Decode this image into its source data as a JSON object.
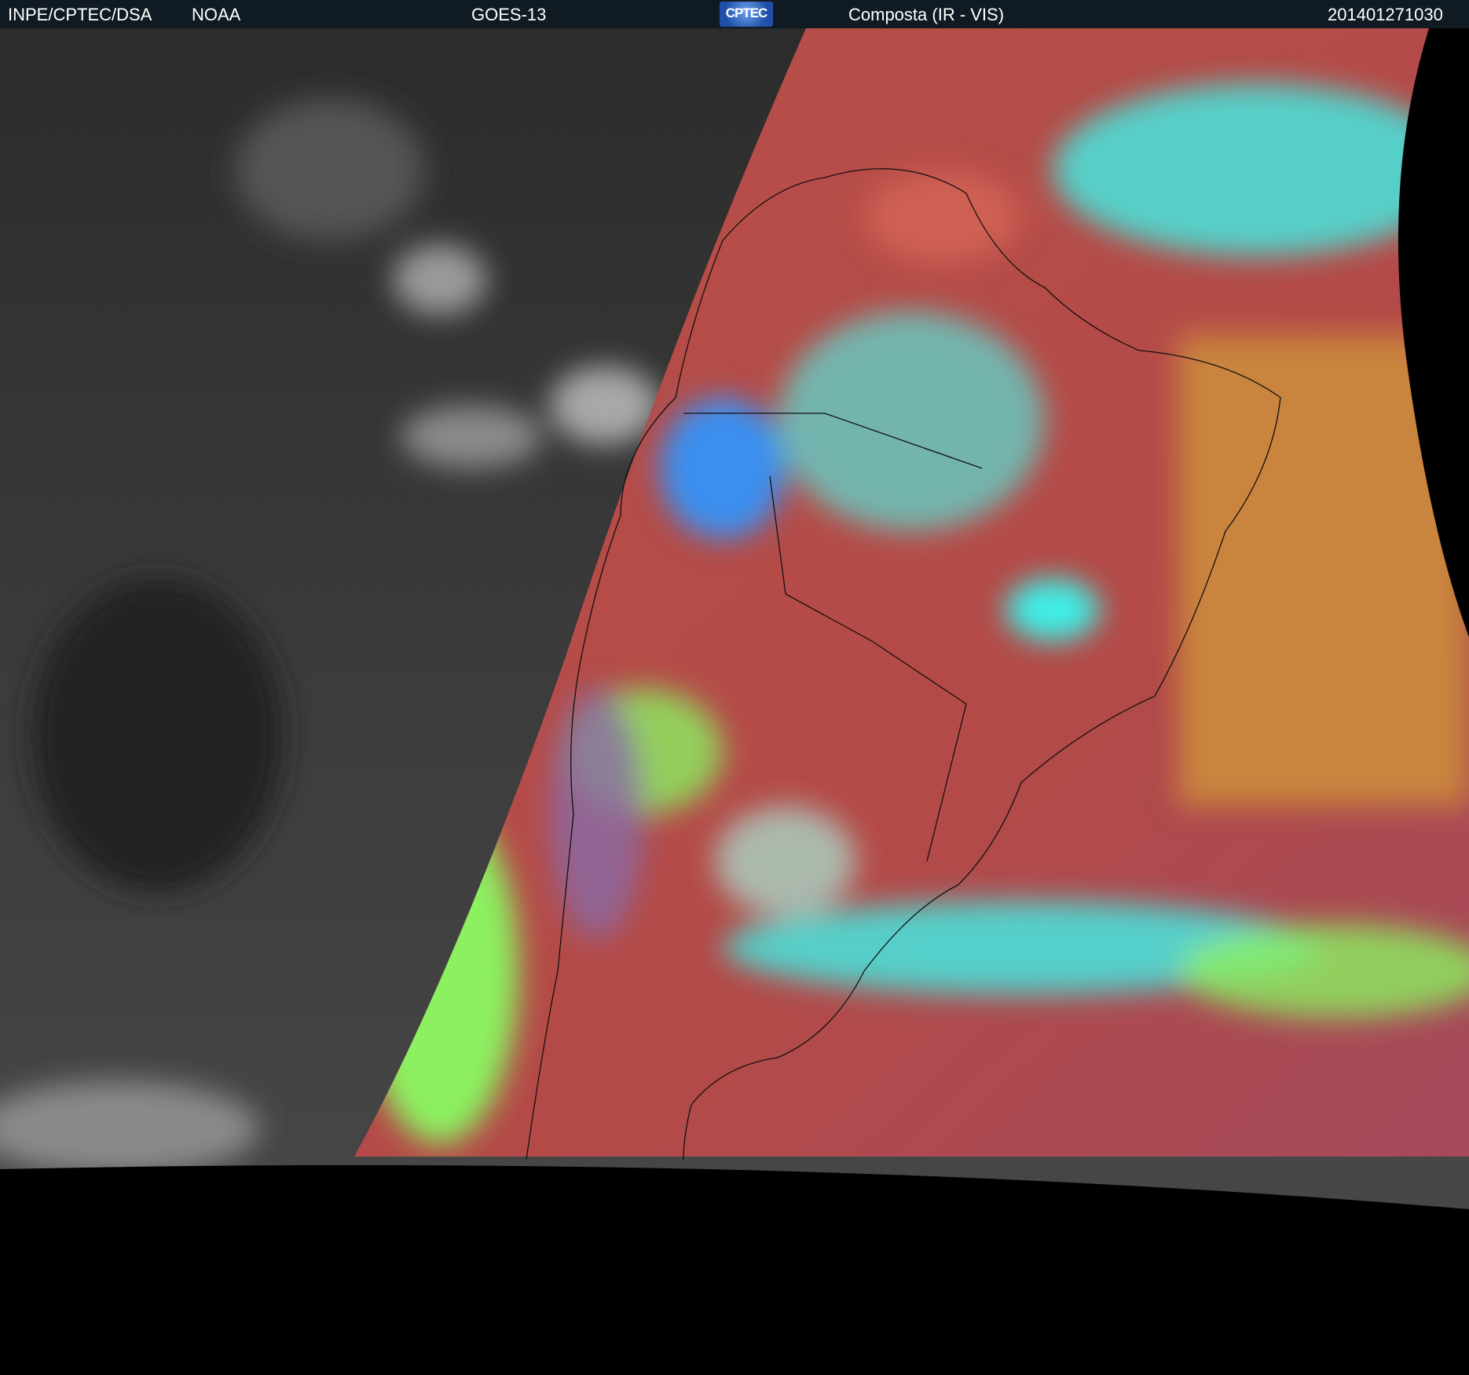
{
  "header": {
    "institution": "INPE/CPTEC/DSA",
    "agency": "NOAA",
    "satellite": "GOES-13",
    "logo_text": "CPTEC",
    "product": "Composta (IR - VIS)",
    "timestamp": "201401271030"
  },
  "colors": {
    "header_bg": "#0f1a22",
    "night_gray": "#3a3a3a",
    "ocean_red": "#b84a45",
    "cloud_cyan": "#3ef0e8",
    "cloud_green": "#8cf060",
    "orange_sea": "#c9843e"
  }
}
